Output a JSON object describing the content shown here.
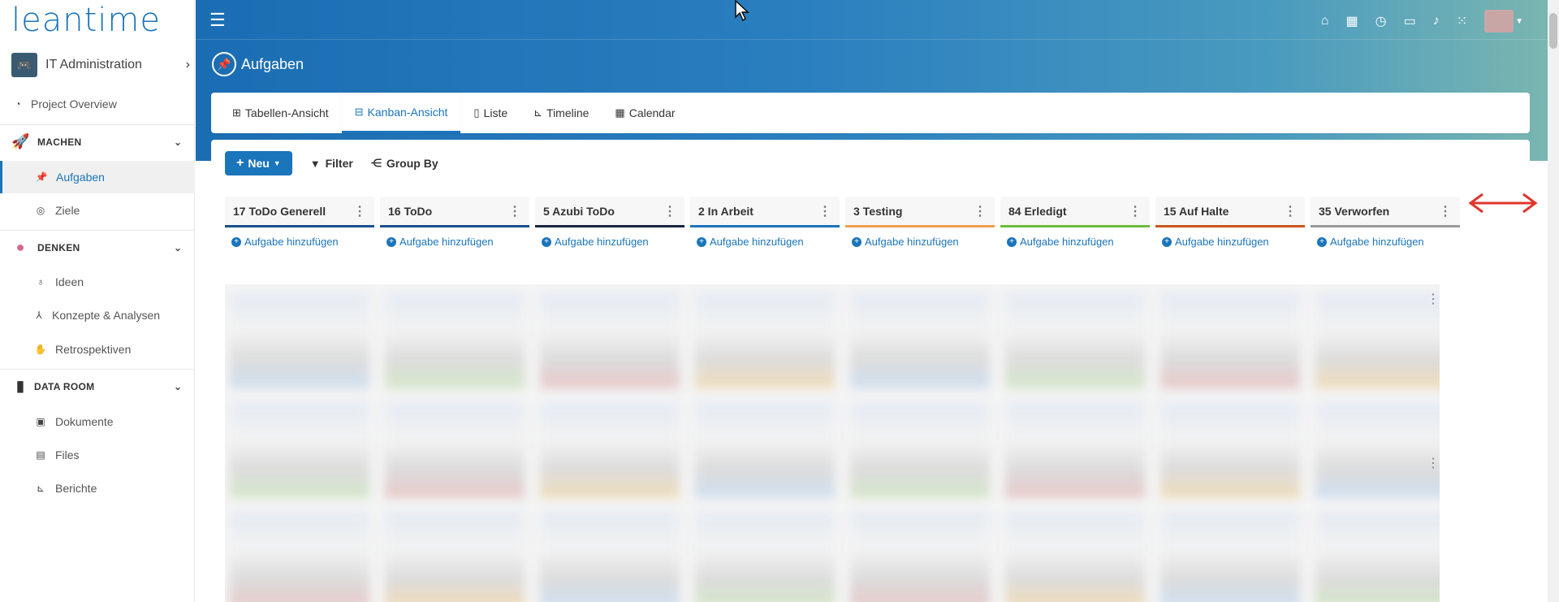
{
  "app": {
    "logo": "leantime"
  },
  "project": {
    "name": "IT Administration",
    "chevron": "›"
  },
  "sidebar": {
    "overview": "Project Overview",
    "sections": [
      {
        "label": "MACHEN",
        "icon": "rocket-icon",
        "items": [
          "Aufgaben",
          "Ziele"
        ]
      },
      {
        "label": "DENKEN",
        "icon": "brain-icon",
        "items": [
          "Ideen",
          "Konzepte & Analysen",
          "Retrospektiven"
        ]
      },
      {
        "label": "DATA ROOM",
        "icon": "usb-icon",
        "items": [
          "Dokumente",
          "Files",
          "Berichte"
        ]
      }
    ],
    "active_item": "Aufgaben"
  },
  "header": {
    "title": "Aufgaben"
  },
  "tabs": [
    {
      "label": "Tabellen-Ansicht",
      "icon": "table-icon"
    },
    {
      "label": "Kanban-Ansicht",
      "icon": "kanban-icon"
    },
    {
      "label": "Liste",
      "icon": "list-icon"
    },
    {
      "label": "Timeline",
      "icon": "timeline-icon"
    },
    {
      "label": "Calendar",
      "icon": "calendar-icon"
    }
  ],
  "active_tab": "Kanban-Ansicht",
  "toolbar": {
    "new_label": "Neu",
    "filter_label": "Filter",
    "groupby_label": "Group By"
  },
  "columns": [
    {
      "title": "17 ToDo Generell",
      "color": "#1b4f8f"
    },
    {
      "title": "16 ToDo",
      "color": "#1b4f8f"
    },
    {
      "title": "5 Azubi ToDo",
      "color": "#1a2540"
    },
    {
      "title": "2 In Arbeit",
      "color": "#1b75bb"
    },
    {
      "title": "3 Testing",
      "color": "#f0a04b"
    },
    {
      "title": "84 Erledigt",
      "color": "#6bbd3c"
    },
    {
      "title": "15 Auf Halte",
      "color": "#c8571b"
    },
    {
      "title": "35 Verworfen",
      "color": "#9a9a9a"
    }
  ],
  "add_task_label": "Aufgabe hinzufügen",
  "colors": {
    "brand": "#1b75bb",
    "arrow": "#e0352b"
  }
}
